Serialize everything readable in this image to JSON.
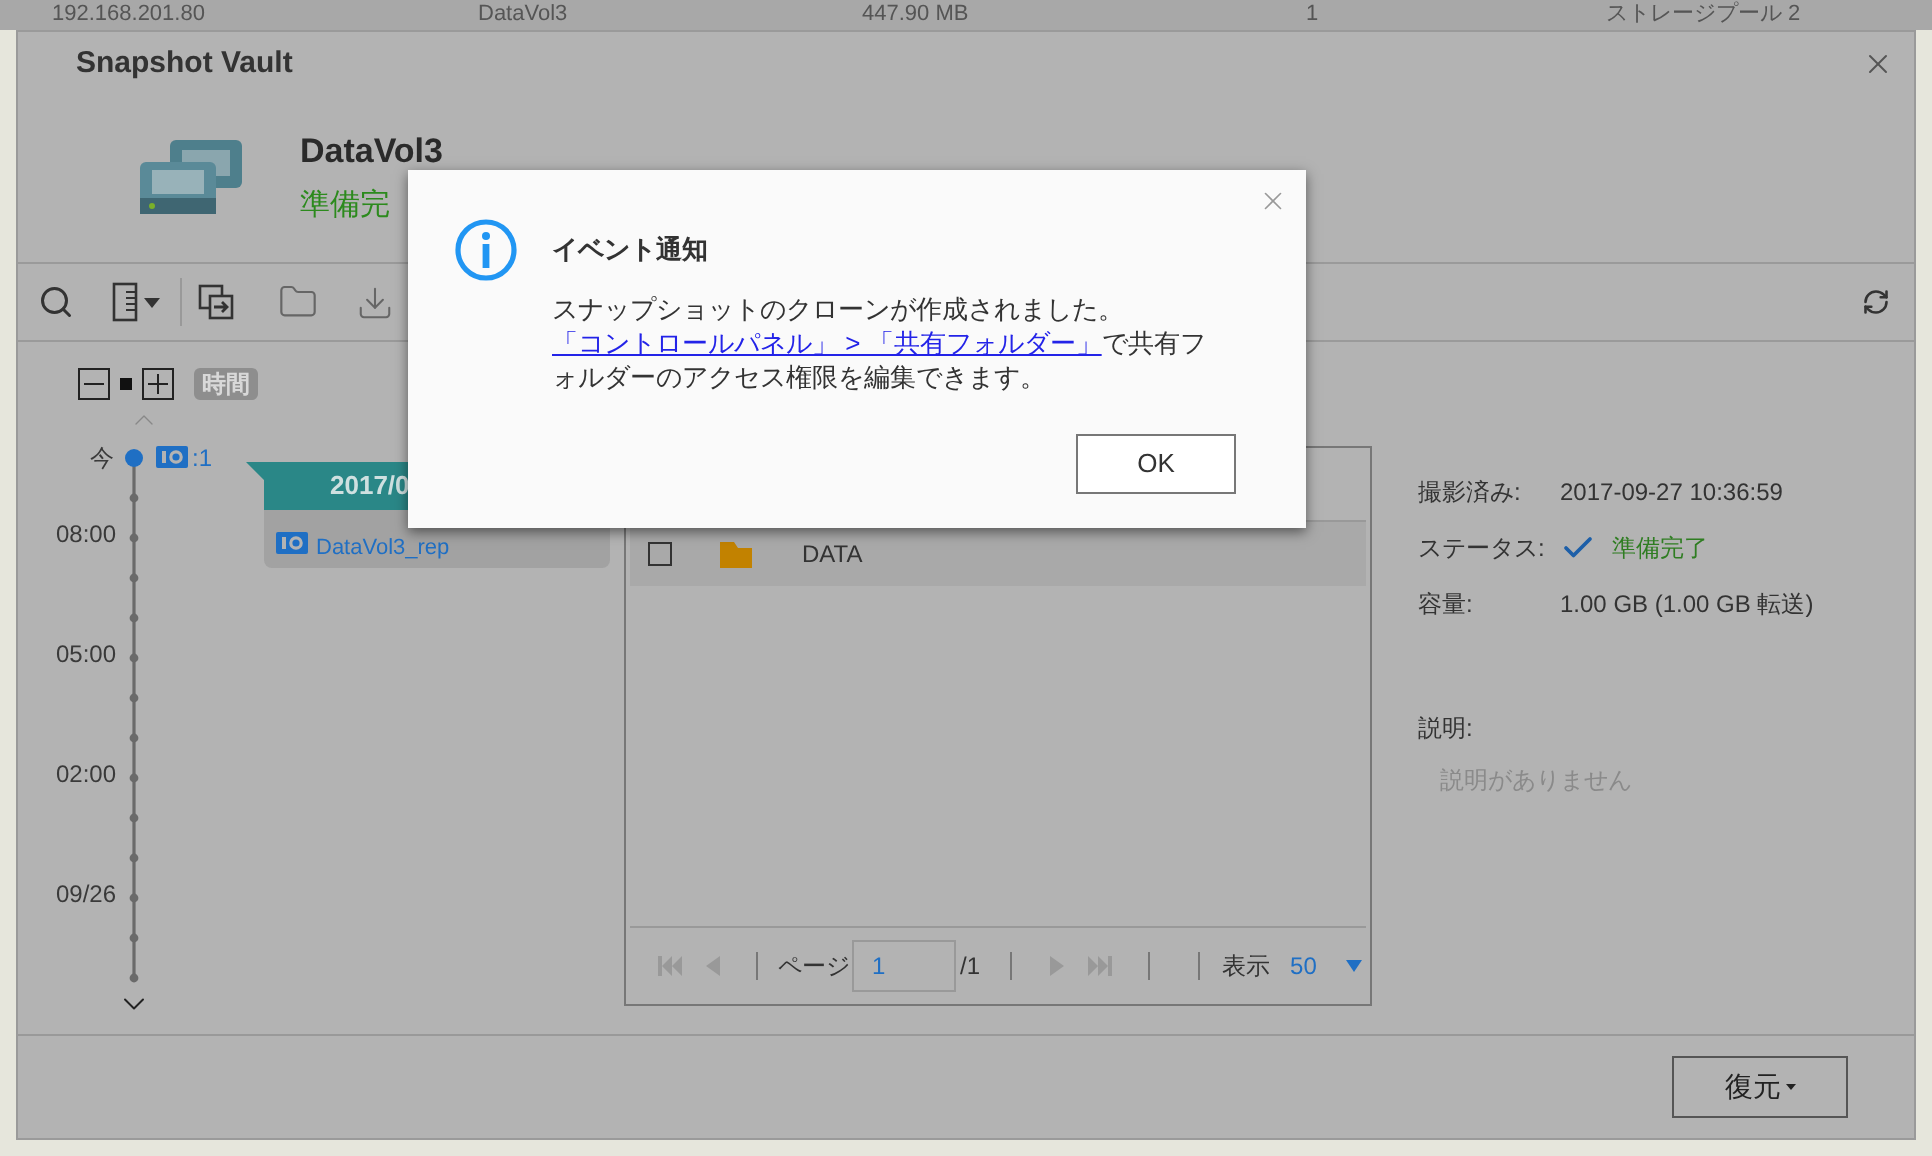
{
  "background_row": [
    "192.168.201.80",
    "DataVol3",
    "447.90 MB",
    "1",
    "ストレージプール 2"
  ],
  "window": {
    "title": "Snapshot Vault",
    "volume_name": "DataVol3",
    "volume_status": "準備完"
  },
  "timeline": {
    "scale_label": "時間",
    "now_label": "今",
    "now_count": ":1",
    "ticks": [
      "08:00",
      "05:00",
      "02:00",
      "09/26"
    ]
  },
  "snapshot_group": {
    "date": "2017/0",
    "items": [
      {
        "name": "DataVol3_rep"
      }
    ]
  },
  "file_list": {
    "rows": [
      {
        "name": "DATA",
        "checked": false
      }
    ],
    "pager": {
      "page_label": "ページ",
      "page_value": "1",
      "total": "/1",
      "show_label": "表示",
      "per_page": "50"
    }
  },
  "details": {
    "fields": [
      {
        "label": "撮影済み:",
        "value": "2017-09-27 10:36:59",
        "kind": "text"
      },
      {
        "label": "ステータス:",
        "value": "準備完了",
        "kind": "status"
      },
      {
        "label": "容量:",
        "value": "1.00 GB (1.00 GB 転送)",
        "kind": "text"
      }
    ],
    "description_label": "説明:",
    "description_text": "説明がありません"
  },
  "footer_button": "復元",
  "dialog": {
    "title": "イベント通知",
    "message_before": "スナップショットのクローンが作成されました。",
    "link": "「コントロールパネル」 > 「共有フォルダー」",
    "message_after": "で共有フォルダーのアクセス権限を編集できます。",
    "ok": "OK"
  }
}
